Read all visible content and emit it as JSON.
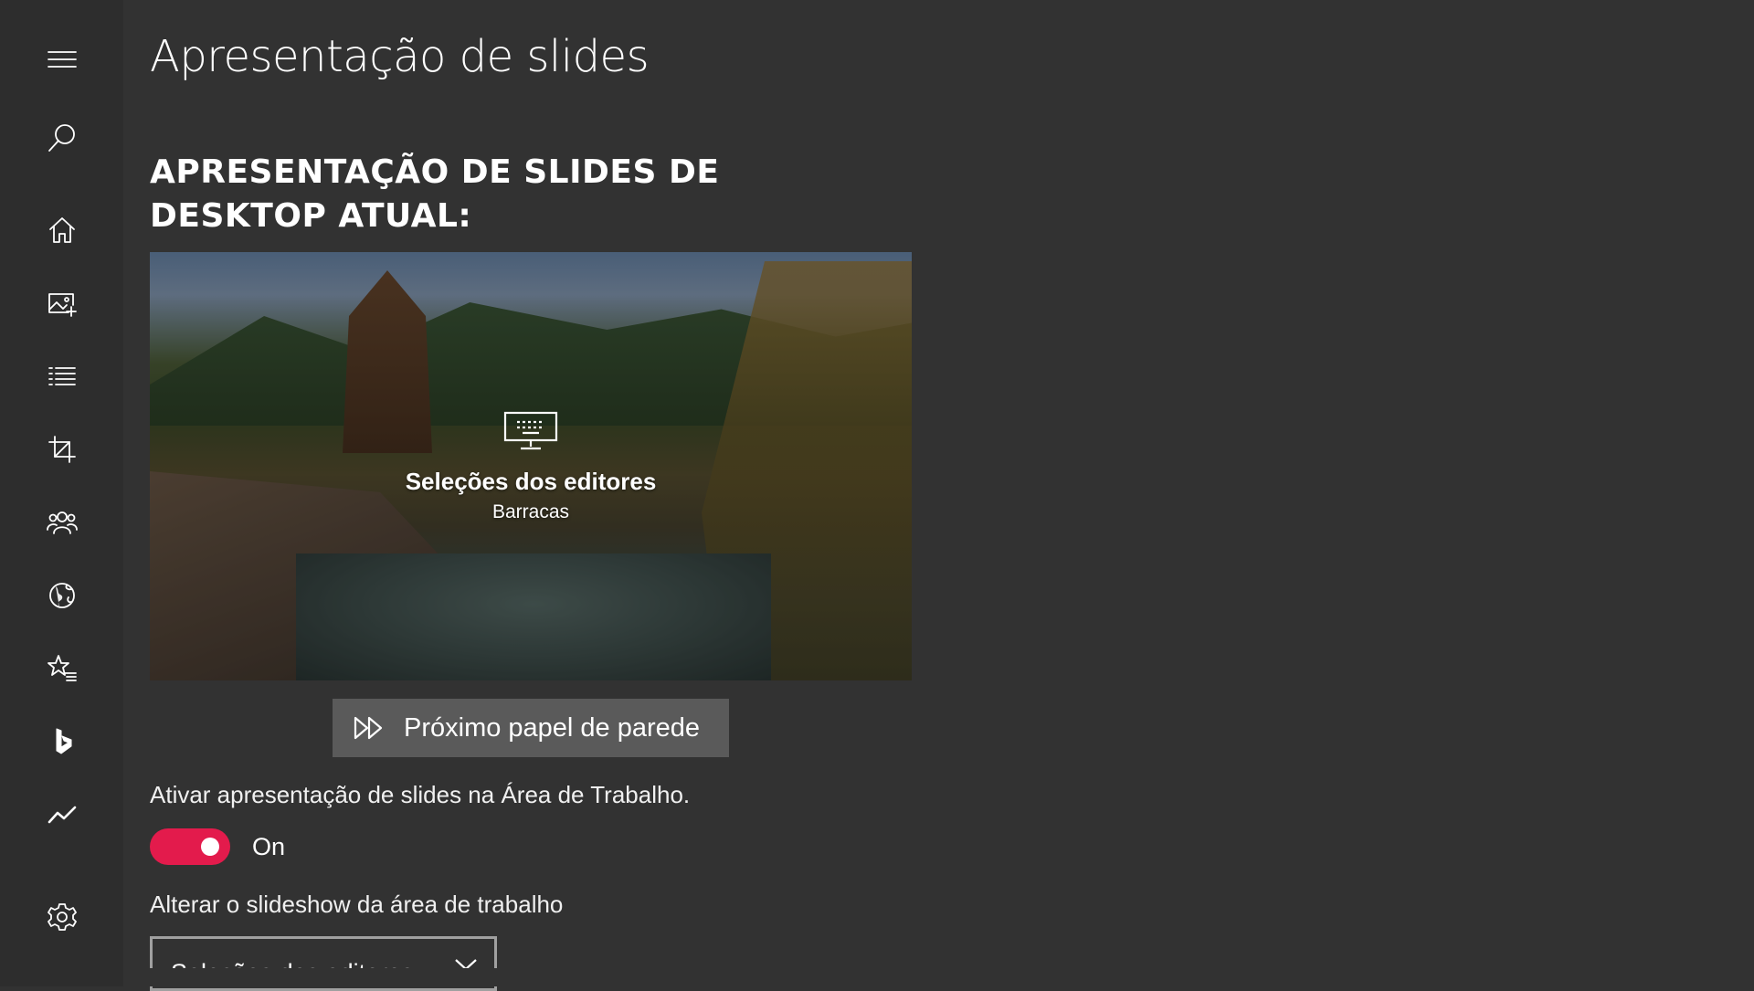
{
  "sidebar": {
    "items": [
      {
        "icon": "hamburger-menu-icon"
      },
      {
        "icon": "search-icon"
      },
      {
        "icon": "home-icon"
      },
      {
        "icon": "image-add-icon"
      },
      {
        "icon": "list-icon"
      },
      {
        "icon": "crop-icon"
      },
      {
        "icon": "people-icon"
      },
      {
        "icon": "globe-icon"
      },
      {
        "icon": "star-list-icon"
      },
      {
        "icon": "bing-icon"
      },
      {
        "icon": "trend-chart-icon"
      },
      {
        "icon": "settings-gear-icon"
      }
    ]
  },
  "page": {
    "title": "Apresentação de slides",
    "section_heading": "APRESENTAÇÃO DE SLIDES DE DESKTOP ATUAL:"
  },
  "preview": {
    "title": "Seleções dos editores",
    "subtitle": "Barracas"
  },
  "next_button": {
    "label": "Próximo papel de parede"
  },
  "slideshow_toggle": {
    "label": "Ativar apresentação de slides na Área de Trabalho.",
    "state": "On",
    "on_color": "#e31b4c"
  },
  "slideshow_select": {
    "label": "Alterar o slideshow da área de trabalho",
    "value": "Seleções dos editores"
  },
  "colors": {
    "background": "#323232",
    "sidebar": "#2d2d2d",
    "button": "#5a5a5a",
    "accent": "#e31b4c"
  }
}
